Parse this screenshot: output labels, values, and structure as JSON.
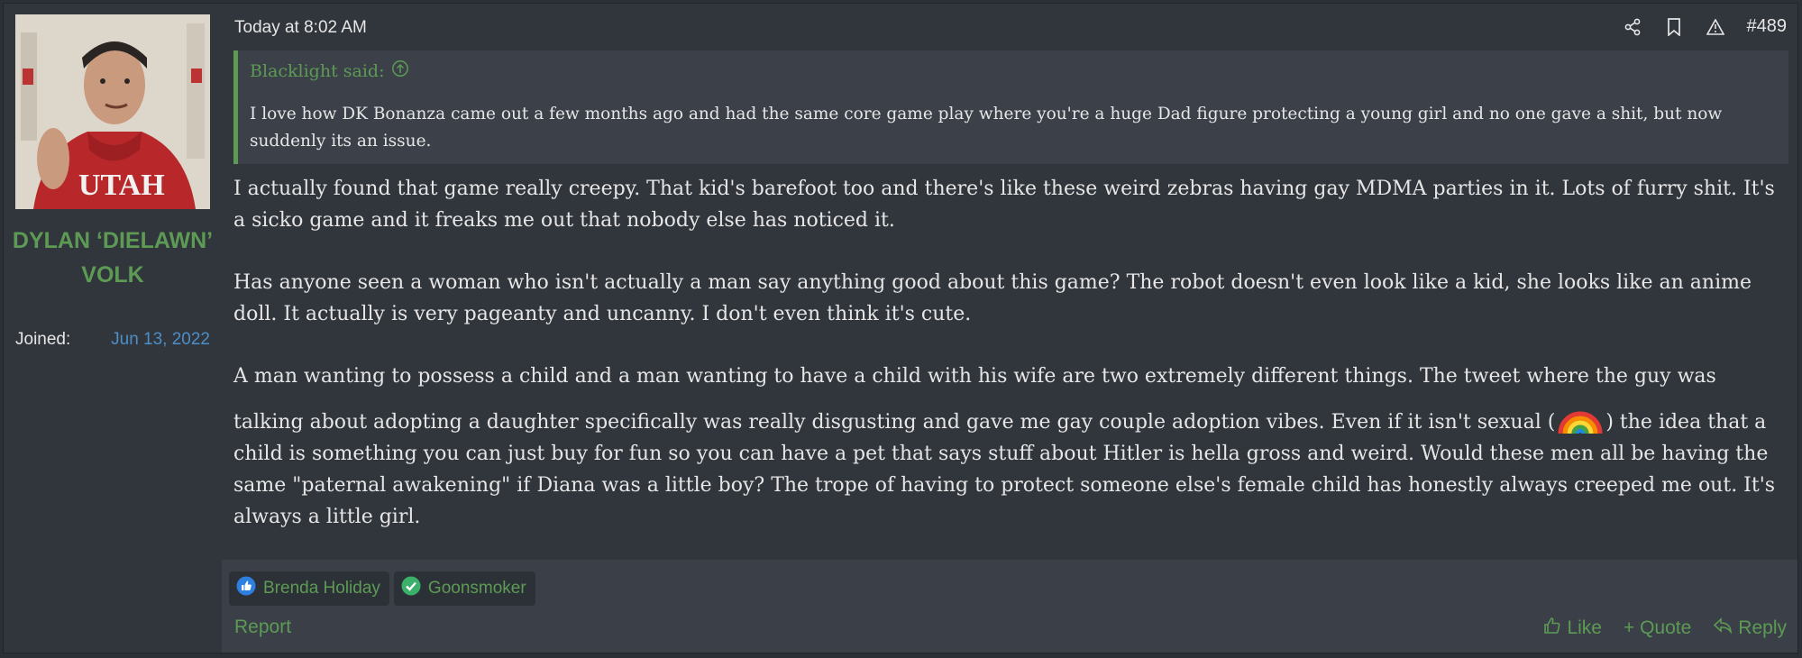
{
  "user": {
    "name": "DYLAN ‘DIELAWN’ VOLK",
    "joined_label": "Joined:",
    "joined_date": "Jun 13, 2022"
  },
  "post": {
    "date": "Today at 8:02 AM",
    "number": "#489",
    "quote": {
      "author": "Blacklight said:",
      "text": "I love how DK Bonanza came out a few months ago and had the same core game play where you're a huge Dad figure protecting a young girl and no one gave a shit, but now suddenly its an issue."
    },
    "paragraphs": [
      "I actually found that game really creepy. That kid's barefoot too and there's like these weird zebras having gay MDMA parties in it. Lots of furry shit. It's a sicko game and it freaks me out that nobody else has noticed it.",
      "Has anyone seen a woman who isn't actually a man say anything good about this game? The robot doesn't even look like a kid, she looks like an anime doll. It actually is very pageanty and uncanny. I don't even think it's cute."
    ],
    "paragraph3_before": "A man wanting to possess a child and a man wanting to have a child with his wife are two extremely different things. The tweet where the guy was talking about adopting a daughter specifically was really disgusting and gave me gay couple adoption vibes. Even if it isn't sexual (",
    "paragraph3_emoji": "rainbow-emoji",
    "paragraph3_after": ") the idea that a child is something you can just buy for fun so you can have a pet that says stuff about Hitler is hella gross and weird. Would these men all be having the same \"paternal awakening\" if Diana was a little boy? The trope of having to protect someone else's female child has honestly always creeped me out. It's always a little girl."
  },
  "reactions": [
    {
      "icon": "thumbs-up-icon",
      "name": "Brenda Holiday"
    },
    {
      "icon": "checkmark-icon",
      "name": "Goonsmoker"
    }
  ],
  "footer": {
    "report": "Report",
    "like": "Like",
    "quote": "+ Quote",
    "reply": "Reply"
  },
  "colors": {
    "accent": "#5d9b55",
    "date_link": "#4d8fc6",
    "background": "#31353c"
  }
}
